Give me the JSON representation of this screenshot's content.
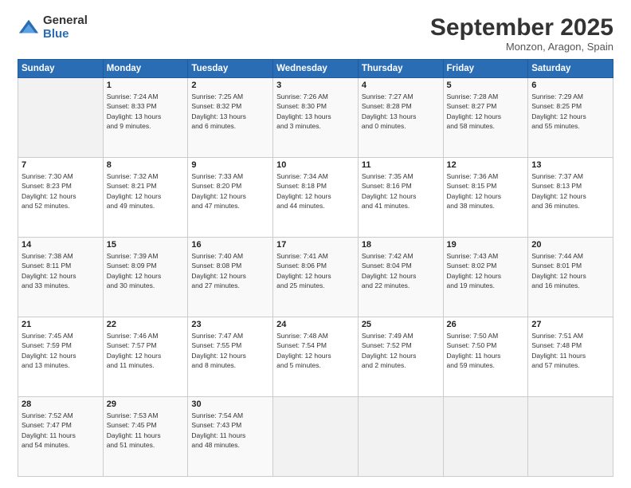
{
  "header": {
    "logo": {
      "general": "General",
      "blue": "Blue"
    },
    "title": "September 2025",
    "location": "Monzon, Aragon, Spain"
  },
  "days_of_week": [
    "Sunday",
    "Monday",
    "Tuesday",
    "Wednesday",
    "Thursday",
    "Friday",
    "Saturday"
  ],
  "weeks": [
    [
      {
        "day": "",
        "info": ""
      },
      {
        "day": "1",
        "info": "Sunrise: 7:24 AM\nSunset: 8:33 PM\nDaylight: 13 hours\nand 9 minutes."
      },
      {
        "day": "2",
        "info": "Sunrise: 7:25 AM\nSunset: 8:32 PM\nDaylight: 13 hours\nand 6 minutes."
      },
      {
        "day": "3",
        "info": "Sunrise: 7:26 AM\nSunset: 8:30 PM\nDaylight: 13 hours\nand 3 minutes."
      },
      {
        "day": "4",
        "info": "Sunrise: 7:27 AM\nSunset: 8:28 PM\nDaylight: 13 hours\nand 0 minutes."
      },
      {
        "day": "5",
        "info": "Sunrise: 7:28 AM\nSunset: 8:27 PM\nDaylight: 12 hours\nand 58 minutes."
      },
      {
        "day": "6",
        "info": "Sunrise: 7:29 AM\nSunset: 8:25 PM\nDaylight: 12 hours\nand 55 minutes."
      }
    ],
    [
      {
        "day": "7",
        "info": "Sunrise: 7:30 AM\nSunset: 8:23 PM\nDaylight: 12 hours\nand 52 minutes."
      },
      {
        "day": "8",
        "info": "Sunrise: 7:32 AM\nSunset: 8:21 PM\nDaylight: 12 hours\nand 49 minutes."
      },
      {
        "day": "9",
        "info": "Sunrise: 7:33 AM\nSunset: 8:20 PM\nDaylight: 12 hours\nand 47 minutes."
      },
      {
        "day": "10",
        "info": "Sunrise: 7:34 AM\nSunset: 8:18 PM\nDaylight: 12 hours\nand 44 minutes."
      },
      {
        "day": "11",
        "info": "Sunrise: 7:35 AM\nSunset: 8:16 PM\nDaylight: 12 hours\nand 41 minutes."
      },
      {
        "day": "12",
        "info": "Sunrise: 7:36 AM\nSunset: 8:15 PM\nDaylight: 12 hours\nand 38 minutes."
      },
      {
        "day": "13",
        "info": "Sunrise: 7:37 AM\nSunset: 8:13 PM\nDaylight: 12 hours\nand 36 minutes."
      }
    ],
    [
      {
        "day": "14",
        "info": "Sunrise: 7:38 AM\nSunset: 8:11 PM\nDaylight: 12 hours\nand 33 minutes."
      },
      {
        "day": "15",
        "info": "Sunrise: 7:39 AM\nSunset: 8:09 PM\nDaylight: 12 hours\nand 30 minutes."
      },
      {
        "day": "16",
        "info": "Sunrise: 7:40 AM\nSunset: 8:08 PM\nDaylight: 12 hours\nand 27 minutes."
      },
      {
        "day": "17",
        "info": "Sunrise: 7:41 AM\nSunset: 8:06 PM\nDaylight: 12 hours\nand 25 minutes."
      },
      {
        "day": "18",
        "info": "Sunrise: 7:42 AM\nSunset: 8:04 PM\nDaylight: 12 hours\nand 22 minutes."
      },
      {
        "day": "19",
        "info": "Sunrise: 7:43 AM\nSunset: 8:02 PM\nDaylight: 12 hours\nand 19 minutes."
      },
      {
        "day": "20",
        "info": "Sunrise: 7:44 AM\nSunset: 8:01 PM\nDaylight: 12 hours\nand 16 minutes."
      }
    ],
    [
      {
        "day": "21",
        "info": "Sunrise: 7:45 AM\nSunset: 7:59 PM\nDaylight: 12 hours\nand 13 minutes."
      },
      {
        "day": "22",
        "info": "Sunrise: 7:46 AM\nSunset: 7:57 PM\nDaylight: 12 hours\nand 11 minutes."
      },
      {
        "day": "23",
        "info": "Sunrise: 7:47 AM\nSunset: 7:55 PM\nDaylight: 12 hours\nand 8 minutes."
      },
      {
        "day": "24",
        "info": "Sunrise: 7:48 AM\nSunset: 7:54 PM\nDaylight: 12 hours\nand 5 minutes."
      },
      {
        "day": "25",
        "info": "Sunrise: 7:49 AM\nSunset: 7:52 PM\nDaylight: 12 hours\nand 2 minutes."
      },
      {
        "day": "26",
        "info": "Sunrise: 7:50 AM\nSunset: 7:50 PM\nDaylight: 11 hours\nand 59 minutes."
      },
      {
        "day": "27",
        "info": "Sunrise: 7:51 AM\nSunset: 7:48 PM\nDaylight: 11 hours\nand 57 minutes."
      }
    ],
    [
      {
        "day": "28",
        "info": "Sunrise: 7:52 AM\nSunset: 7:47 PM\nDaylight: 11 hours\nand 54 minutes."
      },
      {
        "day": "29",
        "info": "Sunrise: 7:53 AM\nSunset: 7:45 PM\nDaylight: 11 hours\nand 51 minutes."
      },
      {
        "day": "30",
        "info": "Sunrise: 7:54 AM\nSunset: 7:43 PM\nDaylight: 11 hours\nand 48 minutes."
      },
      {
        "day": "",
        "info": ""
      },
      {
        "day": "",
        "info": ""
      },
      {
        "day": "",
        "info": ""
      },
      {
        "day": "",
        "info": ""
      }
    ]
  ]
}
